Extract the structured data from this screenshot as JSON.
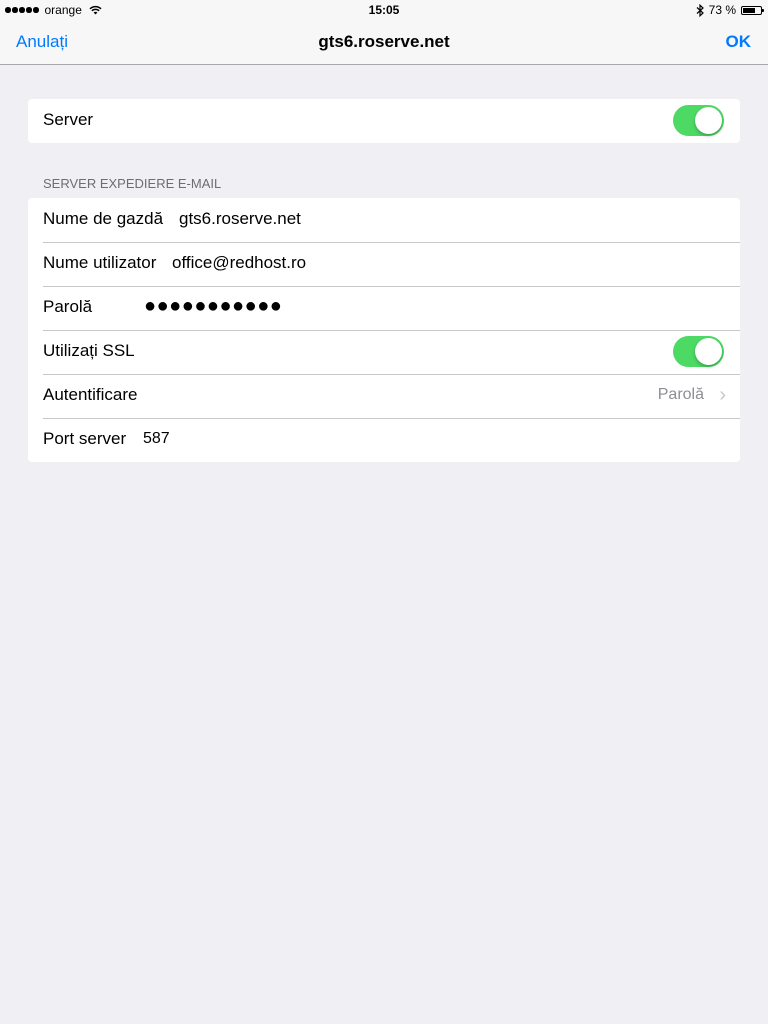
{
  "status_bar": {
    "carrier": "orange",
    "time": "15:05",
    "battery_text": "73 %",
    "battery_level": 0.73
  },
  "nav": {
    "cancel_label": "Anulați",
    "title": "gts6.roserve.net",
    "ok_label": "OK"
  },
  "server_toggle": {
    "label": "Server",
    "on": true
  },
  "section": {
    "header": "SERVER EXPEDIERE E-MAIL",
    "rows": {
      "hostname": {
        "label": "Nume de gazdă",
        "value": "gts6.roserve.net"
      },
      "username": {
        "label": "Nume utilizator",
        "value": "office@redhost.ro"
      },
      "password": {
        "label": "Parolă",
        "masked": "●●●●●●●●●●●"
      },
      "ssl": {
        "label": "Utilizați SSL",
        "on": true
      },
      "auth": {
        "label": "Autentificare",
        "value": "Parolă"
      },
      "port": {
        "label": "Port server",
        "value": "587"
      }
    }
  },
  "colors": {
    "accent": "#007aff",
    "toggle_on": "#4cd964",
    "background": "#efeff4"
  }
}
